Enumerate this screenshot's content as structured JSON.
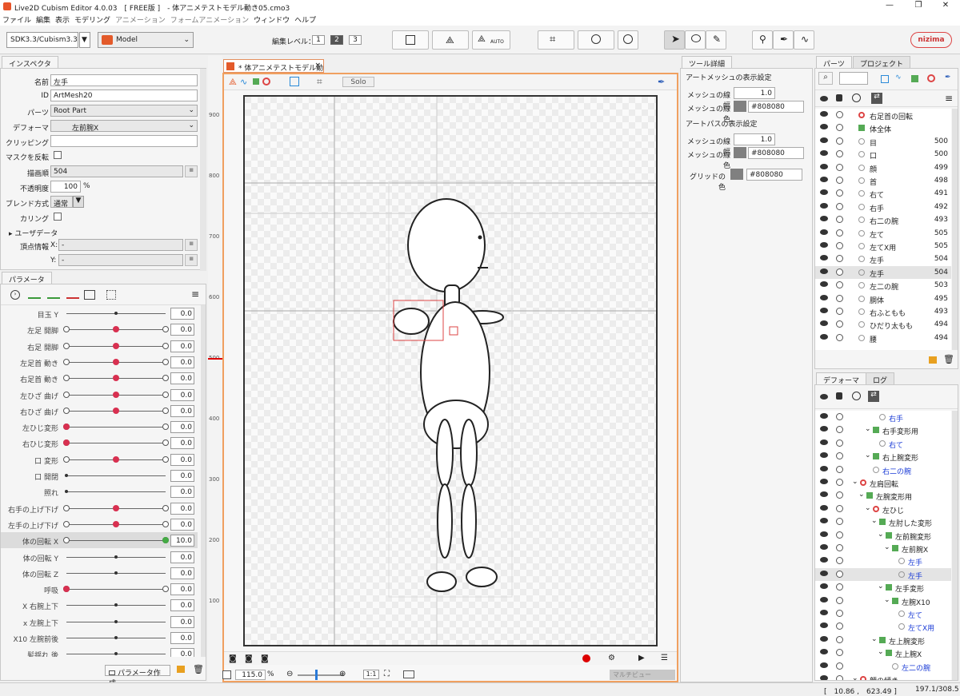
{
  "app": {
    "title": "Live2D Cubism Editor 4.0.03　[ FREE版 ]　- 体アニメテストモデル動き05.cmo3"
  },
  "window_buttons": {
    "min": "—",
    "max": "❐",
    "close": "✕"
  },
  "menu": [
    {
      "label": "ファイル",
      "dim": false
    },
    {
      "label": "編集",
      "dim": false
    },
    {
      "label": "表示",
      "dim": false
    },
    {
      "label": "モデリング",
      "dim": false
    },
    {
      "label": "アニメーション",
      "dim": true
    },
    {
      "label": "フォームアニメーション",
      "dim": true
    },
    {
      "label": "ウィンドウ",
      "dim": false
    },
    {
      "label": "ヘルプ",
      "dim": false
    }
  ],
  "toolbar": {
    "sdk": "SDK3.3/Cubism3.3",
    "mode": "Model",
    "edit_level_label": "編集レベル：",
    "levels": [
      "1",
      "2",
      "3"
    ],
    "auto_label": "AUTO",
    "brand": "nizima"
  },
  "inspector": {
    "tab": "インスペクタ",
    "name_label": "名前",
    "name": "左手",
    "id_label": "ID",
    "id": "ArtMesh20",
    "parts_label": "パーツ",
    "parts": "Root Part",
    "deformer_label": "デフォーマ",
    "deformer": "左前腕X",
    "clipping_label": "クリッピング",
    "clipping": "",
    "mask_invert_label": "マスクを反転",
    "draw_order_label": "描画順",
    "draw_order": "504",
    "opacity_label": "不透明度",
    "opacity": "100",
    "opacity_unit": "%",
    "blend_label": "ブレンド方式",
    "blend": "通常",
    "culling_label": "カリング",
    "userdata_label": "ユーザデータ",
    "vertex_label": "頂点情報",
    "x_label": "X:",
    "x": "-",
    "y_label": "Y:",
    "y": "-"
  },
  "params": {
    "tab": "パラメータ",
    "create_btn": "パラメータ作成",
    "rows": [
      {
        "name": "目玉 Y",
        "value": "0.0",
        "knob": 0.5,
        "style": "dot",
        "sel": false
      },
      {
        "name": "左足 開脚",
        "value": "0.0",
        "knob": 0.5,
        "style": "red",
        "sel": false
      },
      {
        "name": "右足 開脚",
        "value": "0.0",
        "knob": 0.5,
        "style": "red",
        "sel": false
      },
      {
        "name": "左足首 動き",
        "value": "0.0",
        "knob": 0.5,
        "style": "red",
        "sel": false
      },
      {
        "name": "右足首 動き",
        "value": "0.0",
        "knob": 0.5,
        "style": "red",
        "sel": false
      },
      {
        "name": "左ひざ 曲げ",
        "value": "0.0",
        "knob": 0.5,
        "style": "red",
        "sel": false
      },
      {
        "name": "右ひざ 曲げ",
        "value": "0.0",
        "knob": 0.5,
        "style": "red",
        "sel": false
      },
      {
        "name": "左ひじ変形",
        "value": "0.0",
        "knob": 0.0,
        "style": "red",
        "sel": false
      },
      {
        "name": "右ひじ変形",
        "value": "0.0",
        "knob": 0.0,
        "style": "red",
        "sel": false
      },
      {
        "name": "口 変形",
        "value": "0.0",
        "knob": 0.5,
        "style": "red",
        "sel": false
      },
      {
        "name": "口 開閉",
        "value": "0.0",
        "knob": 0.0,
        "style": "dot",
        "sel": false
      },
      {
        "name": "照れ",
        "value": "0.0",
        "knob": 0.0,
        "style": "dot",
        "sel": false
      },
      {
        "name": "右手の上げ下げ",
        "value": "0.0",
        "knob": 0.5,
        "style": "red",
        "sel": false
      },
      {
        "name": "左手の上げ下げ",
        "value": "0.0",
        "knob": 0.5,
        "style": "red",
        "sel": false
      },
      {
        "name": "体の回転 X",
        "value": "10.0",
        "knob": 1.0,
        "style": "green",
        "sel": true
      },
      {
        "name": "体の回転 Y",
        "value": "0.0",
        "knob": 0.5,
        "style": "dot",
        "sel": false
      },
      {
        "name": "体の回転 Z",
        "value": "0.0",
        "knob": 0.5,
        "style": "dot",
        "sel": false
      },
      {
        "name": "呼吸",
        "value": "0.0",
        "knob": 0.0,
        "style": "red",
        "sel": false
      },
      {
        "name": "X 右腕上下",
        "value": "0.0",
        "knob": 0.5,
        "style": "dot",
        "sel": false
      },
      {
        "name": "x 左腕上下",
        "value": "0.0",
        "knob": 0.5,
        "style": "dot",
        "sel": false
      },
      {
        "name": "X10 左腕前後",
        "value": "0.0",
        "knob": 0.5,
        "style": "dot",
        "sel": false
      },
      {
        "name": "髪揺れ 後",
        "value": "0.0",
        "knob": 0.5,
        "style": "dot",
        "sel": false
      }
    ]
  },
  "canvas": {
    "tab": "* 体アニメテストモデル動き",
    "solo": "Solo",
    "ruler": [
      "900",
      "800",
      "700",
      "600",
      "500",
      "400",
      "300",
      "200",
      "100"
    ],
    "zoom": "115.0",
    "zoom_unit": "%",
    "ratio": "1:1",
    "multiview": "マルチビュー"
  },
  "tool_detail": {
    "tab": "ツール詳細",
    "section1": "アートメッシュの表示設定",
    "line_width_label": "メッシュの線幅",
    "line_width": "1.0",
    "line_color_label": "メッシュの線色",
    "line_color": "#808080",
    "section2": "アートパスの表示設定",
    "path_width_label": "メッシュの線幅",
    "path_width": "1.0",
    "path_color_label": "メッシュの線色",
    "path_color": "#808080",
    "grid_label": "グリッドの色",
    "grid_color": "#808080"
  },
  "parts_panel": {
    "tabs": [
      "パーツ",
      "プロジェクト"
    ],
    "items": [
      {
        "name": "右足首の回転",
        "num": "",
        "icon": "rot"
      },
      {
        "name": "体全体",
        "num": "",
        "icon": "warp"
      },
      {
        "name": "目",
        "num": "500",
        "icon": "mesh"
      },
      {
        "name": "口",
        "num": "500",
        "icon": "mesh"
      },
      {
        "name": "顔",
        "num": "499",
        "icon": "mesh"
      },
      {
        "name": "首",
        "num": "498",
        "icon": "mesh"
      },
      {
        "name": "右て",
        "num": "491",
        "icon": "mesh"
      },
      {
        "name": "右手",
        "num": "492",
        "icon": "mesh"
      },
      {
        "name": "右二の腕",
        "num": "493",
        "icon": "mesh"
      },
      {
        "name": "左て",
        "num": "505",
        "icon": "mesh"
      },
      {
        "name": "左てX用",
        "num": "505",
        "icon": "mesh"
      },
      {
        "name": "左手",
        "num": "504",
        "icon": "mesh"
      },
      {
        "name": "左手",
        "num": "504",
        "icon": "mesh",
        "sel": true
      },
      {
        "name": "左二の腕",
        "num": "503",
        "icon": "mesh"
      },
      {
        "name": "胴体",
        "num": "495",
        "icon": "mesh"
      },
      {
        "name": "右ふともも",
        "num": "493",
        "icon": "mesh"
      },
      {
        "name": "ひだり太もも",
        "num": "494",
        "icon": "mesh"
      },
      {
        "name": "腰",
        "num": "494",
        "icon": "mesh"
      }
    ]
  },
  "deformer_panel": {
    "tabs": [
      "デフォーマ",
      "ログ"
    ],
    "items": [
      {
        "name": "右手",
        "indent": 5,
        "blue": true,
        "icon": "mesh"
      },
      {
        "name": "右手変形用",
        "indent": 4,
        "blue": false,
        "icon": "warp"
      },
      {
        "name": "右て",
        "indent": 5,
        "blue": true,
        "icon": "mesh"
      },
      {
        "name": "右上腕変形",
        "indent": 4,
        "blue": false,
        "icon": "warp"
      },
      {
        "name": "右二の腕",
        "indent": 4,
        "blue": true,
        "icon": "mesh"
      },
      {
        "name": "左肩回転",
        "indent": 2,
        "blue": false,
        "icon": "rot"
      },
      {
        "name": "左腕変形用",
        "indent": 3,
        "blue": false,
        "icon": "warp"
      },
      {
        "name": "左ひじ",
        "indent": 4,
        "blue": false,
        "icon": "rot"
      },
      {
        "name": "左肘した変形",
        "indent": 5,
        "blue": false,
        "icon": "warp"
      },
      {
        "name": "左前腕変形",
        "indent": 6,
        "blue": false,
        "icon": "warp"
      },
      {
        "name": "左前腕X",
        "indent": 7,
        "blue": false,
        "icon": "warp"
      },
      {
        "name": "左手",
        "indent": 8,
        "blue": true,
        "icon": "mesh"
      },
      {
        "name": "左手",
        "indent": 8,
        "blue": true,
        "icon": "mesh",
        "sel": true
      },
      {
        "name": "左手変形",
        "indent": 6,
        "blue": false,
        "icon": "warp"
      },
      {
        "name": "左腕X10",
        "indent": 7,
        "blue": false,
        "icon": "warp"
      },
      {
        "name": "左て",
        "indent": 8,
        "blue": true,
        "icon": "mesh"
      },
      {
        "name": "左てX用",
        "indent": 8,
        "blue": true,
        "icon": "mesh"
      },
      {
        "name": "左上腕変形",
        "indent": 5,
        "blue": false,
        "icon": "warp"
      },
      {
        "name": "左上腕X",
        "indent": 6,
        "blue": false,
        "icon": "warp"
      },
      {
        "name": "左二の腕",
        "indent": 7,
        "blue": true,
        "icon": "mesh"
      },
      {
        "name": "顔の傾き",
        "indent": 2,
        "blue": false,
        "icon": "rot"
      }
    ]
  },
  "status": {
    "coords": "[　10.86 ,　623.49 ]",
    "fps": "197.1/308.5"
  }
}
